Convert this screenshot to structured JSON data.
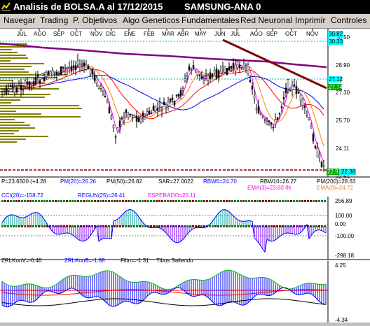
{
  "window": {
    "title": "Analisis de BOLSA.A al 17/12/2015",
    "ticker": "SAMSUNG-ANA 0"
  },
  "menu": [
    "Navegar",
    "Trading",
    "P. Objetivos",
    "Algo Geneticos",
    "Fundamentales",
    "Red Neuronal",
    "Imprimir",
    "Controles"
  ],
  "months": [
    "JUL",
    "AGO",
    "SEP",
    "OCT",
    "NOV",
    "DIC",
    "ENE",
    "FEB",
    "MAR",
    "ABR",
    "MAY",
    "JUN",
    "JUL",
    "AGO",
    "SEP",
    "OCT",
    "NOV"
  ],
  "price_panel": {
    "y_ticks": [
      "30.50",
      "28.90",
      "27.30",
      "25.70",
      "24.11",
      "22.51"
    ],
    "boxes": [
      {
        "text": "30.82",
        "bg": "#00ffff"
      },
      {
        "text": "30.33",
        "bg": "#00ffff"
      },
      {
        "text": "27.74",
        "bg": "#00a000"
      },
      {
        "text": "27.12",
        "bg": "#00ffff"
      },
      {
        "text": "22.9",
        "bg": "#00a000"
      },
      {
        "text": "22.38",
        "bg": "#00ffff"
      }
    ],
    "info_row1": {
      "p": "P=23.6500 (+4.28",
      "pm20": "PM(20)=26.26",
      "pm50": "PM(50)=26.82",
      "sar": "SAR=27.0022",
      "rbw6": "RBW6=24.70",
      "rbw10": "RBW10=26.27",
      "pm200": "PM(200)=28.63"
    },
    "info_row2": {
      "ema3": "EMA(3)=23.60 IN",
      "ema8": "EMA(8)=24.72"
    }
  },
  "cci_panel": {
    "labels": {
      "cci": "CCI(20)=-158.72",
      "regun": "REGUN(25)=26.41",
      "esperado": "ESPERADO=26.11"
    },
    "y_ticks": [
      "256.89",
      "100.00",
      "0.00",
      "-100.00",
      "-298.18"
    ]
  },
  "zrl_panel": {
    "labels": {
      "zrlkonv": "ZRLKonV=-0.40",
      "zrlkonb": "ZRLKonB=-1.88",
      "filtro": "Filtro=-1.31",
      "tibus": "Tibus Saliendo"
    },
    "y_ticks": [
      "4.25",
      "-4.34"
    ]
  },
  "colors": {
    "candle_up": "#ffffff",
    "candle_down": "#000000",
    "pm200": "#800080",
    "trendline": "#800000",
    "pm20": "#ff0000",
    "pm50": "#0000ff",
    "ema": "#ff8000",
    "fast": "#ff00ff",
    "volume_profile": "#808000",
    "cci": "#0000ff",
    "zrl_green": "#00c000",
    "zrl_blue": "#0000ff",
    "zrl_red": "#ff0000"
  }
}
